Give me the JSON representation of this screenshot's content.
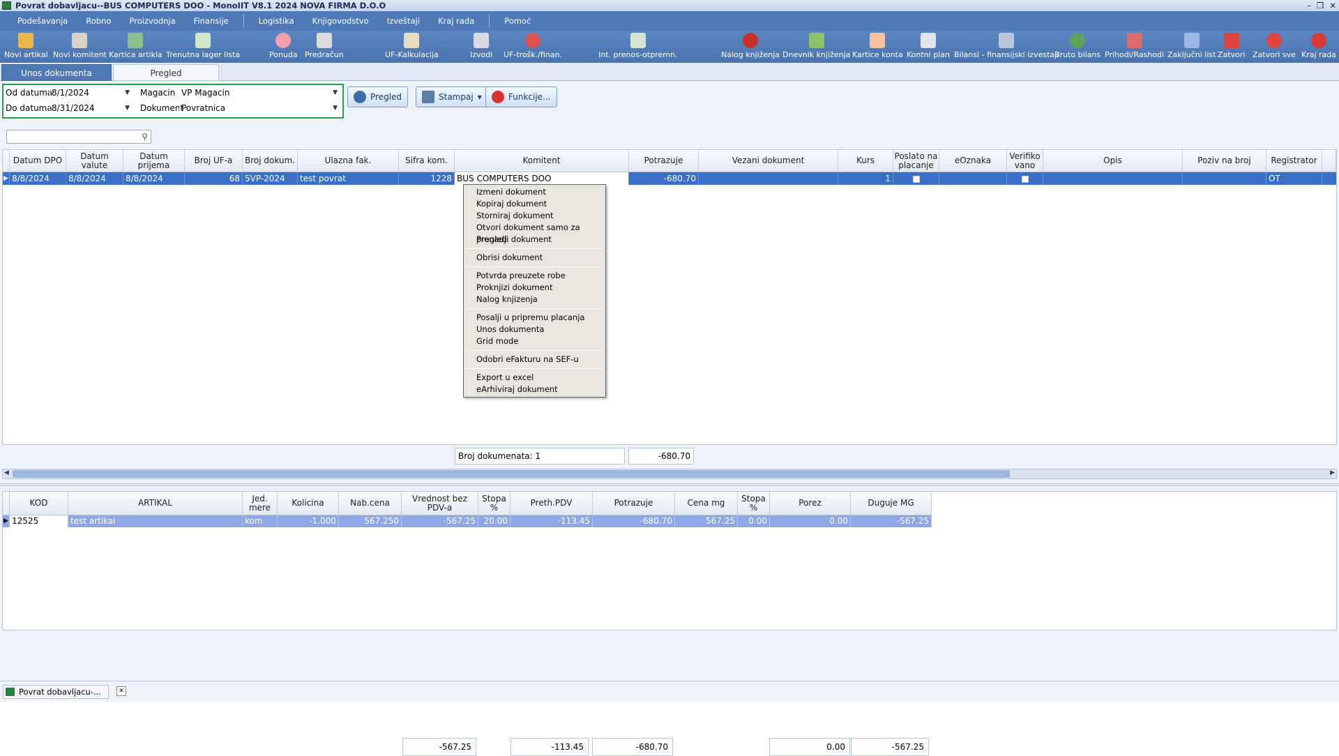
{
  "window": {
    "title": "Povrat dobavljacu--BUS COMPUTERS DOO - MonoIIT V8.1 2024 NOVA FIRMA D.O.O"
  },
  "menu": [
    "Podešavanja",
    "Robno",
    "Proizvodnja",
    "Finansije",
    "Logistika",
    "Knjigovodstvo",
    "Izveštaji",
    "Kraj rada",
    "Pomoć"
  ],
  "toolbar": [
    "Novi artikal",
    "Novi komitent",
    "Kartica artikla",
    "Trenutna lager lista",
    "Ponuda",
    "Predračun",
    "UF-Kalkulacija",
    "Izvodi",
    "UF-trošk./finan.",
    "Int. prenos-otpremn.",
    "Nalog knjiženja",
    "Dnevnik knjiženja",
    "Kartice konta",
    "Kontni plan",
    "Bilansi - finansijski izvestaji",
    "Bruto bilans",
    "Prihodi/Rashodi",
    "Zaključni list",
    "Zatvori",
    "Zatvori sve",
    "Kraj rada"
  ],
  "tabs": {
    "entry": "Unos dokumenta",
    "review": "Pregled"
  },
  "filter": {
    "from_label": "Od datuma",
    "from_value": "8/1/2024",
    "to_label": "Do datuma",
    "to_value": "8/31/2024",
    "warehouse_label": "Magacin",
    "warehouse_value": "VP Magacin",
    "doc_label": "Dokument",
    "doc_value": "Povratnica"
  },
  "buttons": {
    "review": "Pregled",
    "print": "Stampaj",
    "functions": "Funkcije..."
  },
  "grid": {
    "headers": [
      "Datum DPO",
      "Datum valute",
      "Datum prijema",
      "Broj UF-a",
      "Broj dokum.",
      "Ulazna fak.",
      "Sifra kom.",
      "Komitent",
      "Potrazuje",
      "Vezani dokument",
      "Kurs",
      "Poslato na placanje",
      "eOznaka",
      "Verifiko vano",
      "Opis",
      "Poziv na broj",
      "Registrator"
    ],
    "row": [
      "8/8/2024",
      "8/8/2024",
      "8/8/2024",
      "68",
      "5VP-2024",
      "test povrat",
      "1228",
      "BUS COMPUTERS DOO",
      "-680.70",
      "",
      "1",
      "",
      "",
      "",
      "",
      "",
      "OT"
    ]
  },
  "context_menu": {
    "groups": [
      [
        "Izmeni dokument",
        "Kopiraj dokument",
        "Storniraj dokument",
        "Otvori dokument samo za pregled",
        "Pronadji dokument"
      ],
      [
        "Obrisi dokument"
      ],
      [
        "Potvrda preuzete robe",
        "Proknjizi dokument",
        "Nalog knjizenja"
      ],
      [
        "Posalji u pripremu placanja",
        "Unos dokumenta",
        "Grid mode"
      ],
      [
        "Odobri eFakturu na SEF-u"
      ],
      [
        "Export u excel",
        "eArhiviraj dokument"
      ]
    ]
  },
  "summary": {
    "count": "Broj dokumenata: 1",
    "total": "-680.70"
  },
  "items": {
    "headers": [
      "KOD",
      "ARTIKAL",
      "Jed. mere",
      "Kolicina",
      "Nab.cena",
      "Vrednost bez PDV-a",
      "Stopa %",
      "Preth.PDV",
      "Potrazuje",
      "Cena mg",
      "Stopa %",
      "Porez",
      "Duguje MG"
    ],
    "row": [
      "12525",
      "test artikal",
      "kom",
      "-1.000",
      "567.250",
      "-567.25",
      "20.00",
      "-113.45",
      "-680.70",
      "567.25",
      "0.00",
      "0.00",
      "-567.25"
    ],
    "footer": {
      "vrednost": "-567.25",
      "pdv": "-113.45",
      "potrazuje": "-680.70",
      "porez": "0.00",
      "duguje": "-567.25"
    }
  },
  "status": {
    "doc_tab": "Povrat dobavljacu-..."
  }
}
